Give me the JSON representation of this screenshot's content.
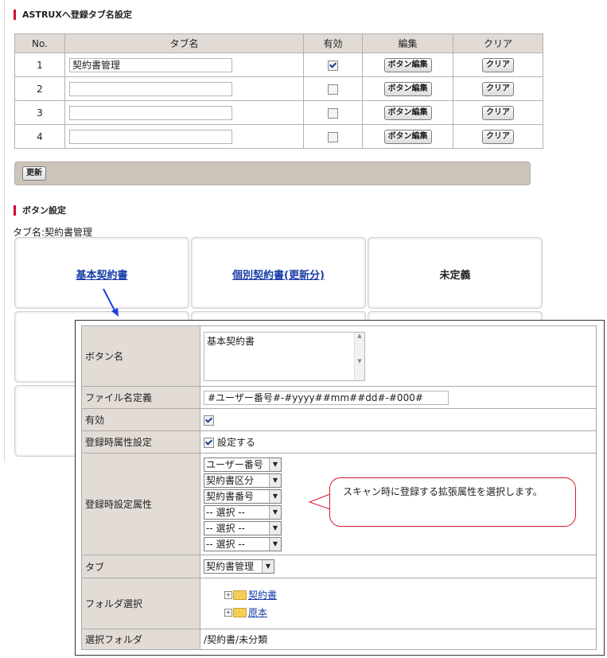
{
  "tabs_section": {
    "title": "ASTRUXへ登録タブ名設定",
    "headers": [
      "No.",
      "タブ名",
      "有効",
      "編集",
      "クリア"
    ],
    "rows": [
      {
        "no": "1",
        "name": "契約書管理",
        "enabled": true
      },
      {
        "no": "2",
        "name": "",
        "enabled": false
      },
      {
        "no": "3",
        "name": "",
        "enabled": false
      },
      {
        "no": "4",
        "name": "",
        "enabled": false
      }
    ],
    "edit_button": "ボタン編集",
    "clear_button": "クリア",
    "update_button": "更新"
  },
  "button_section": {
    "title": "ボタン設定",
    "tab_name_label": "タブ名:契約書管理",
    "buttons": [
      "基本契約書",
      "個別契約書(更新分)",
      "未定義"
    ]
  },
  "dialog": {
    "labels": {
      "button_name": "ボタン名",
      "file_name": "ファイル名定義",
      "enabled": "有効",
      "attr_on_register": "登録時属性設定",
      "attr_fields": "登録時設定属性",
      "tab": "タブ",
      "folder_select": "フォルダ選択",
      "selected_folder": "選択フォルダ"
    },
    "button_name_value": "基本契約書",
    "file_name_value": "#ユーザー番号#-#yyyy##mm##dd#-#000#",
    "enabled": true,
    "attr_checkbox_label": "設定する",
    "attr_checked": true,
    "attributes": [
      "ユーザー番号",
      "契約書区分",
      "契約書番号",
      "-- 選択 --",
      "-- 選択 --",
      "-- 選択 --"
    ],
    "tab_value": "契約書管理",
    "folders": [
      "契約書",
      "原本"
    ],
    "selected_folder_value": "/契約書/未分類"
  },
  "callout": {
    "text": "スキャン時に登録する拡張属性を選択します。"
  },
  "colors": {
    "accent_red": "#c8102e",
    "header_bg": "#e2dbd5",
    "link_blue": "#1a3ca8",
    "arrow_blue": "#1a3fe0"
  }
}
